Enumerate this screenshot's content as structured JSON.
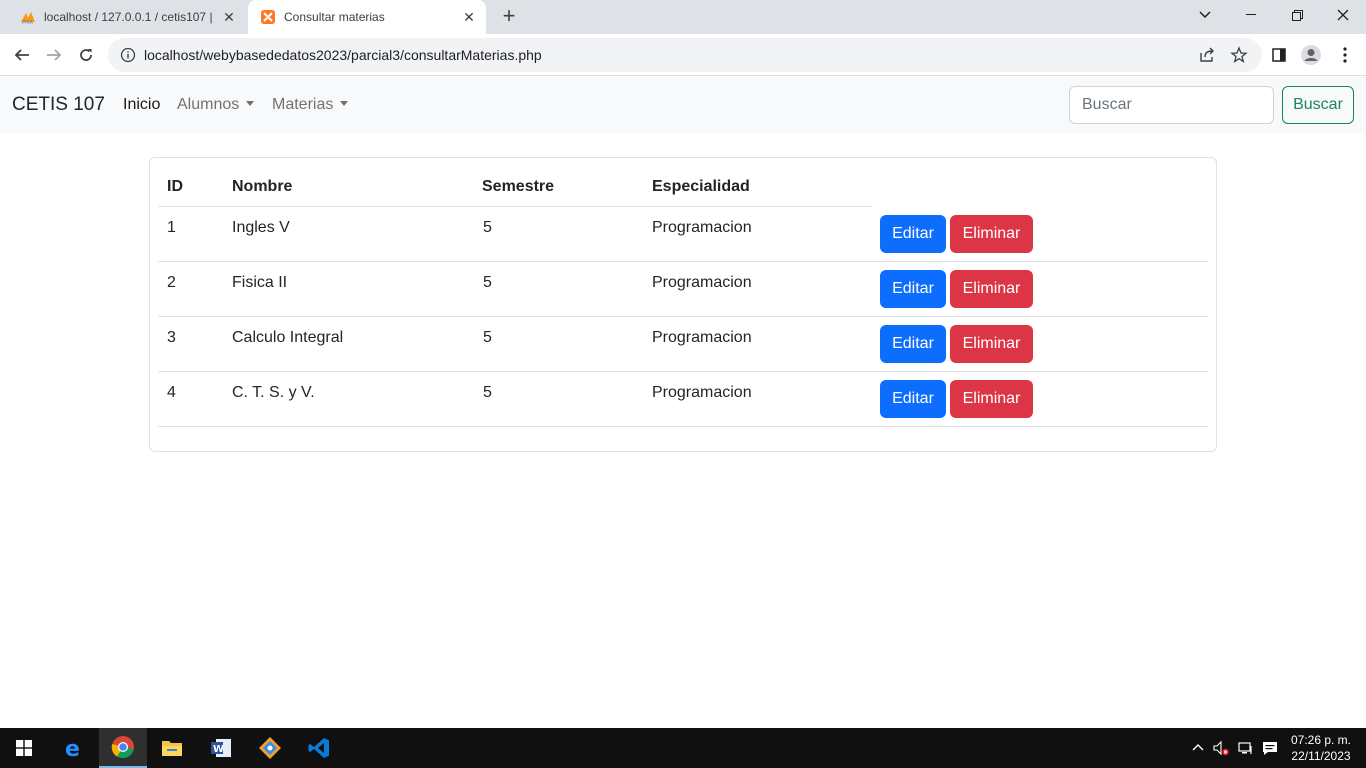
{
  "browser": {
    "tabs": [
      {
        "title": "localhost / 127.0.0.1 / cetis107 | ",
        "active": false
      },
      {
        "title": "Consultar materias",
        "active": true
      }
    ],
    "url": "localhost/webybasededatos2023/parcial3/consultarMaterias.php"
  },
  "navbar": {
    "brand": "CETIS 107",
    "links": [
      {
        "label": "Inicio",
        "active": true
      },
      {
        "label": "Alumnos",
        "dropdown": true
      },
      {
        "label": "Materias",
        "dropdown": true
      }
    ],
    "search_placeholder": "Buscar",
    "search_button": "Buscar"
  },
  "table": {
    "headers": [
      "ID",
      "Nombre",
      "Semestre",
      "Especialidad"
    ],
    "rows": [
      {
        "id": "1",
        "nombre": "Ingles V",
        "semestre": "5",
        "especialidad": "Programacion"
      },
      {
        "id": "2",
        "nombre": "Fisica II",
        "semestre": "5",
        "especialidad": "Programacion"
      },
      {
        "id": "3",
        "nombre": "Calculo Integral",
        "semestre": "5",
        "especialidad": "Programacion"
      },
      {
        "id": "4",
        "nombre": "C. T. S. y V.",
        "semestre": "5",
        "especialidad": "Programacion"
      }
    ],
    "edit_label": "Editar",
    "delete_label": "Eliminar"
  },
  "colors": {
    "primary": "#0d6efd",
    "danger": "#dc3545",
    "success": "#198754",
    "navbar_bg": "#f8f9fa"
  },
  "taskbar": {
    "apps": [
      "windows-start",
      "edge",
      "chrome",
      "file-explorer",
      "word",
      "git",
      "vscode"
    ],
    "time": "07:26 p. m.",
    "date": "22/11/2023"
  }
}
